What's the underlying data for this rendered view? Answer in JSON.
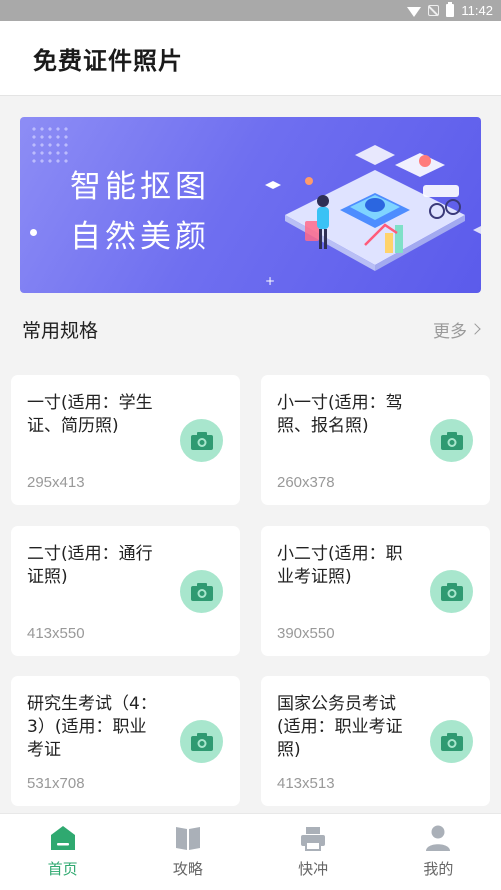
{
  "status_bar": {
    "time": "11:42",
    "icons": [
      "wifi-icon",
      "no-sim-icon",
      "battery-icon"
    ]
  },
  "app_bar": {
    "title": "免费证件照片"
  },
  "banner": {
    "line1": "智能抠图",
    "line2": "自然美颜"
  },
  "section": {
    "title": "常用规格",
    "more_label": "更多"
  },
  "specs": [
    {
      "name": "一寸(适用：学生证、简历照)",
      "size": "295x413"
    },
    {
      "name": "小一寸(适用：驾照、报名照)",
      "size": "260x378"
    },
    {
      "name": "二寸(适用：通行证照)",
      "size": "413x550"
    },
    {
      "name": "小二寸(适用：职业考证照)",
      "size": "390x550"
    },
    {
      "name": "研究生考试（4：3）(适用：职业考证",
      "size": "531x708"
    },
    {
      "name": "国家公务员考试(适用：职业考证照)",
      "size": "413x513"
    }
  ],
  "tabs": [
    {
      "label": "首页",
      "icon": "home-icon",
      "active": true
    },
    {
      "label": "攻略",
      "icon": "book-icon",
      "active": false
    },
    {
      "label": "快冲",
      "icon": "printer-icon",
      "active": false
    },
    {
      "label": "我的",
      "icon": "user-icon",
      "active": false
    }
  ],
  "colors": {
    "accent": "#2fa970",
    "camera_bg": "#a8e6cd",
    "camera_icon": "#2f9a72",
    "banner": "#6f6ff0",
    "inactive_icon": "#aab0b8"
  }
}
